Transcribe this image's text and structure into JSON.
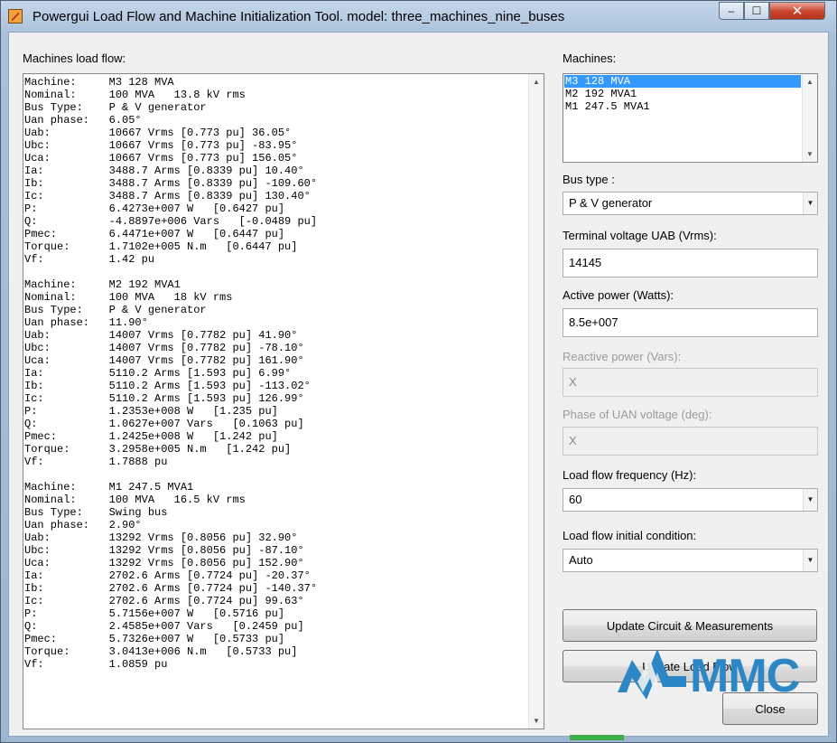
{
  "window": {
    "title": "Powergui Load Flow and Machine Initialization Tool.  model: three_machines_nine_buses",
    "controls": {
      "minimize": "‒",
      "maximize": "☐",
      "close": "✕"
    }
  },
  "loadflow": {
    "label": "Machines load flow:",
    "text": "Machine:     M3 128 MVA\nNominal:     100 MVA   13.8 kV rms\nBus Type:    P & V generator\nUan phase:   6.05°\nUab:         10667 Vrms [0.773 pu] 36.05°\nUbc:         10667 Vrms [0.773 pu] -83.95°\nUca:         10667 Vrms [0.773 pu] 156.05°\nIa:          3488.7 Arms [0.8339 pu] 10.40°\nIb:          3488.7 Arms [0.8339 pu] -109.60°\nIc:          3488.7 Arms [0.8339 pu] 130.40°\nP:           6.4273e+007 W   [0.6427 pu]\nQ:           -4.8897e+006 Vars   [-0.0489 pu]\nPmec:        6.4471e+007 W   [0.6447 pu]\nTorque:      1.7102e+005 N.m   [0.6447 pu]\nVf:          1.42 pu\n\nMachine:     M2 192 MVA1\nNominal:     100 MVA   18 kV rms\nBus Type:    P & V generator\nUan phase:   11.90°\nUab:         14007 Vrms [0.7782 pu] 41.90°\nUbc:         14007 Vrms [0.7782 pu] -78.10°\nUca:         14007 Vrms [0.7782 pu] 161.90°\nIa:          5110.2 Arms [1.593 pu] 6.99°\nIb:          5110.2 Arms [1.593 pu] -113.02°\nIc:          5110.2 Arms [1.593 pu] 126.99°\nP:           1.2353e+008 W   [1.235 pu]\nQ:           1.0627e+007 Vars   [0.1063 pu]\nPmec:        1.2425e+008 W   [1.242 pu]\nTorque:      3.2958e+005 N.m   [1.242 pu]\nVf:          1.7888 pu\n\nMachine:     M1 247.5 MVA1\nNominal:     100 MVA   16.5 kV rms\nBus Type:    Swing bus\nUan phase:   2.90°\nUab:         13292 Vrms [0.8056 pu] 32.90°\nUbc:         13292 Vrms [0.8056 pu] -87.10°\nUca:         13292 Vrms [0.8056 pu] 152.90°\nIa:          2702.6 Arms [0.7724 pu] -20.37°\nIb:          2702.6 Arms [0.7724 pu] -140.37°\nIc:          2702.6 Arms [0.7724 pu] 99.63°\nP:           5.7156e+007 W   [0.5716 pu]\nQ:           2.4585e+007 Vars   [0.2459 pu]\nPmec:        5.7326e+007 W   [0.5733 pu]\nTorque:      3.0413e+006 N.m   [0.5733 pu]\nVf:          1.0859 pu"
  },
  "machines": {
    "label": "Machines:",
    "items": [
      "M3 128 MVA",
      "M2 192 MVA1",
      "M1 247.5 MVA1"
    ],
    "selected_index": 0
  },
  "bus_type": {
    "label": "Bus type :",
    "value": "P & V generator"
  },
  "terminal_voltage": {
    "label": "Terminal voltage UAB (Vrms):",
    "value": "14145"
  },
  "active_power": {
    "label": "Active power (Watts):",
    "value": "8.5e+007"
  },
  "reactive_power": {
    "label": "Reactive power (Vars):",
    "value": "X",
    "disabled": true
  },
  "uan_phase": {
    "label": "Phase of UAN voltage (deg):",
    "value": "X",
    "disabled": true
  },
  "frequency": {
    "label": "Load flow frequency (Hz):",
    "value": "60"
  },
  "initial_condition": {
    "label": "Load flow initial condition:",
    "value": "Auto"
  },
  "buttons": {
    "update_circuit": "Update Circuit & Measurements",
    "update_load_flow": "Update Load Flow",
    "close": "Close"
  },
  "logo": {
    "text": "MMC",
    "color": "#2d86c5"
  },
  "icons": {
    "scroll_up": "▲",
    "scroll_down": "▼",
    "dropdown": "▼"
  },
  "colors": {
    "selection": "#3399ff",
    "close_button": "#c9452c"
  }
}
